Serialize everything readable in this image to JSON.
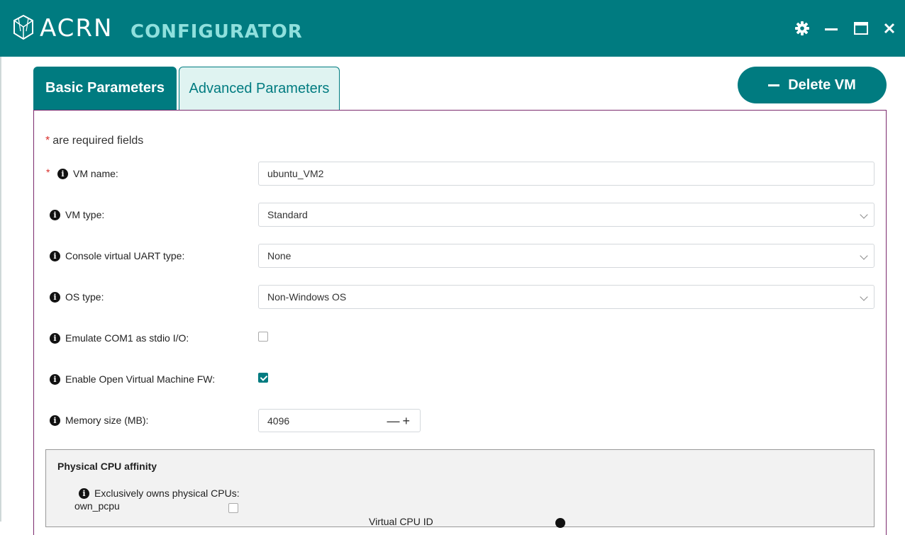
{
  "app": {
    "brand": "ACRN",
    "subbrand": "CONFIGURATOR"
  },
  "tabs": [
    {
      "label": "Basic Parameters",
      "active": true
    },
    {
      "label": "Advanced Parameters",
      "active": false
    }
  ],
  "delete_button": {
    "label": "Delete VM"
  },
  "required_note": {
    "star": "*",
    "text": "are required fields"
  },
  "form": {
    "vm_name": {
      "label": "VM name:",
      "value": "ubuntu_VM2",
      "required": true
    },
    "vm_type": {
      "label": "VM type:",
      "value": "Standard"
    },
    "console_uart": {
      "label": "Console virtual UART type:",
      "value": "None"
    },
    "os_type": {
      "label": "OS type:",
      "value": "Non-Windows OS"
    },
    "emulate_com1": {
      "label": "Emulate COM1 as stdio I/O:",
      "checked": false
    },
    "enable_ovmf": {
      "label": "Enable Open Virtual Machine FW:",
      "checked": true
    },
    "memory_size": {
      "label": "Memory size (MB):",
      "value": "4096",
      "minus": "—",
      "plus": "+"
    }
  },
  "cpu_affinity": {
    "title": "Physical CPU affinity",
    "own_pcpu_label": "Exclusively owns physical CPUs:",
    "own_pcpu_key": "own_pcpu",
    "own_pcpu_checked": false,
    "partial_label": "Virtual CPU ID"
  },
  "colors": {
    "accent": "#007b80",
    "required": "#d9302c",
    "panel_border": "#7b2a6e"
  }
}
